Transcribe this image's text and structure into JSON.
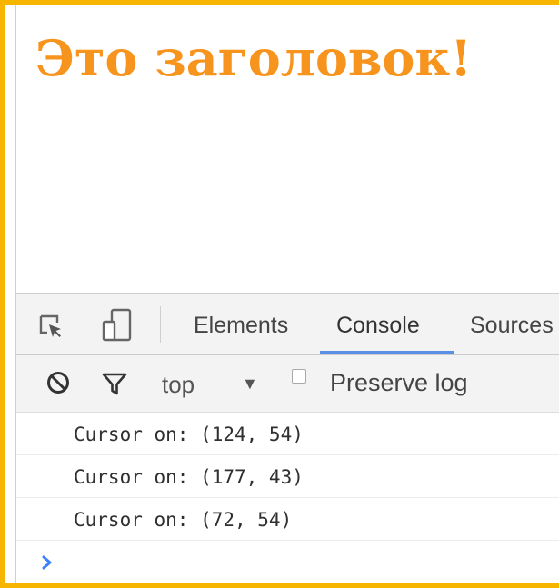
{
  "page": {
    "heading": "Это заголовок!"
  },
  "devtools": {
    "tabs": [
      {
        "label": "Elements",
        "active": false
      },
      {
        "label": "Console",
        "active": true
      },
      {
        "label": "Sources",
        "active": false
      }
    ],
    "toolbar": {
      "inspect_icon": "inspect-element-icon",
      "device_icon": "device-toolbar-icon"
    },
    "filter_bar": {
      "clear_icon": "clear-console-icon",
      "filter_icon": "filter-icon",
      "context": "top",
      "preserve_log_label": "Preserve log",
      "preserve_log_checked": false
    },
    "console": {
      "messages": [
        "Cursor on: (124, 54)",
        "Cursor on: (177, 43)",
        "Cursor on: (72, 54)"
      ],
      "prompt_icon": "prompt-chevron-icon"
    }
  },
  "colors": {
    "heading": "#f7941d",
    "frame_border": "#f7b500",
    "active_tab_underline": "#5a8fe6",
    "prompt": "#3b82f6"
  }
}
